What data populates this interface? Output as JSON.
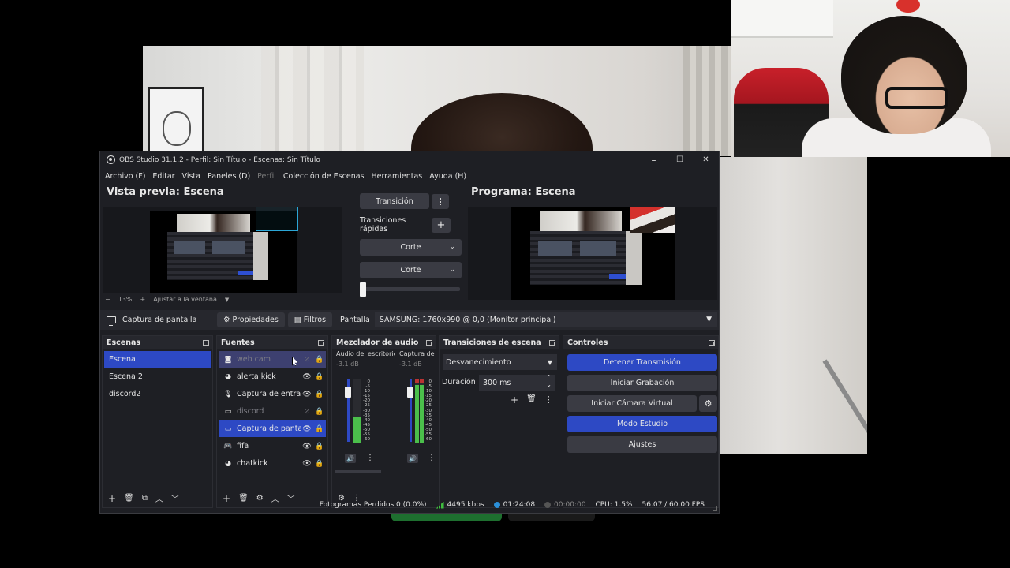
{
  "window": {
    "title": "OBS Studio 31.1.2 - Perfil: Sin Título - Escenas: Sin Título",
    "minimize": "–",
    "maximize": "☐",
    "close": "✕"
  },
  "menu": [
    {
      "label": "Archivo (F)",
      "enabled": true
    },
    {
      "label": "Editar",
      "enabled": true
    },
    {
      "label": "Vista",
      "enabled": true
    },
    {
      "label": "Paneles (D)",
      "enabled": true
    },
    {
      "label": "Perfil",
      "enabled": false
    },
    {
      "label": "Colección de Escenas",
      "enabled": true
    },
    {
      "label": "Herramientas",
      "enabled": true
    },
    {
      "label": "Ayuda (H)",
      "enabled": true
    }
  ],
  "preview": {
    "title": "Vista previa: Escena",
    "zoom_minus": "−",
    "zoom": "13%",
    "zoom_plus": "+",
    "fit": "Ajustar a la ventana",
    "fit_chevron": "▼"
  },
  "program": {
    "title": "Programa: Escena"
  },
  "transition_panel": {
    "transition_button": "Transición",
    "quick_label": "Transiciones rápidas",
    "add": "+",
    "items": [
      "Corte",
      "Corte"
    ],
    "chevron": "⌄"
  },
  "context_bar": {
    "source_name": "Captura de pantalla",
    "properties": "Propiedades",
    "filters": "Filtros",
    "screen_label": "Pantalla",
    "screen_value": "SAMSUNG: 1760x990 @ 0,0 (Monitor principal)",
    "chevron": "▼"
  },
  "scenes": {
    "title": "Escenas",
    "items": [
      "Escena",
      "Escena 2",
      "discord2"
    ],
    "footer": [
      "+",
      "🗑",
      "⧉",
      "︿",
      "﹀"
    ]
  },
  "sources": {
    "title": "Fuentes",
    "items": [
      {
        "name": "web cam",
        "icon": "camera-icon",
        "glyph": "◙",
        "visible": false,
        "locked": true,
        "state": "hover"
      },
      {
        "name": "alerta kick",
        "icon": "browser-icon",
        "glyph": "◕",
        "visible": true,
        "locked": true,
        "state": "normal"
      },
      {
        "name": "Captura de entrada de audio",
        "icon": "microphone-icon",
        "glyph": "🎙",
        "visible": true,
        "locked": true,
        "state": "normal"
      },
      {
        "name": "discord",
        "icon": "window-capture-icon",
        "glyph": "▭",
        "visible": false,
        "locked": true,
        "state": "dim"
      },
      {
        "name": "Captura de pantalla",
        "icon": "monitor-icon",
        "glyph": "▭",
        "visible": true,
        "locked": true,
        "state": "selected"
      },
      {
        "name": "fifa",
        "icon": "gamepad-icon",
        "glyph": "🎮",
        "visible": true,
        "locked": true,
        "state": "normal"
      },
      {
        "name": "chatkick",
        "icon": "browser-icon",
        "glyph": "◕",
        "visible": true,
        "locked": true,
        "state": "normal"
      }
    ],
    "eye": "👁",
    "eye_off": "⊘",
    "lock": "🔒",
    "footer": [
      "+",
      "🗑",
      "⚙",
      "︿",
      "﹀"
    ]
  },
  "mixer": {
    "title": "Mezclador de audio",
    "channels": [
      {
        "name": "Audio del escritorio",
        "db": "-3.1 dB",
        "level_fraction": 0.42
      },
      {
        "name": "Captura de entrada de audio",
        "db": "-3.1 dB",
        "level_fraction": 0.9
      }
    ],
    "scale": [
      "0",
      "-5",
      "-10",
      "-15",
      "-20",
      "-25",
      "-30",
      "-35",
      "-40",
      "-45",
      "-50",
      "-55",
      "-60"
    ],
    "speaker": "🔊",
    "footer": [
      "⚙",
      "⋮"
    ]
  },
  "scene_transitions": {
    "title": "Transiciones de escena",
    "selected": "Desvanecimiento",
    "chevron": "▼",
    "duration_label": "Duración",
    "duration_value": "300 ms",
    "up": "⌃",
    "down": "⌄",
    "actions": [
      "+",
      "🗑",
      "⋮"
    ]
  },
  "controls": {
    "title": "Controles",
    "buttons": [
      "Detener Transmisión",
      "Iniciar Grabación",
      "Iniciar Cámara Virtual",
      "Modo Estudio",
      "Ajustes"
    ],
    "gear": "⚙"
  },
  "status": {
    "dropped": "Fotogramas Perdidos 0 (0.0%)",
    "bitrate": "4495 kbps",
    "stream_time": "01:24:08",
    "rec_time": "00:00:00",
    "cpu": "CPU: 1.5%",
    "fps": "56.07 / 60.00 FPS"
  },
  "colors": {
    "accent": "#2d49c4",
    "panel": "#1e1f24",
    "button": "#3a3b43",
    "live_dot": "#2b8fd8",
    "meter_green": "#4bbf4b"
  }
}
